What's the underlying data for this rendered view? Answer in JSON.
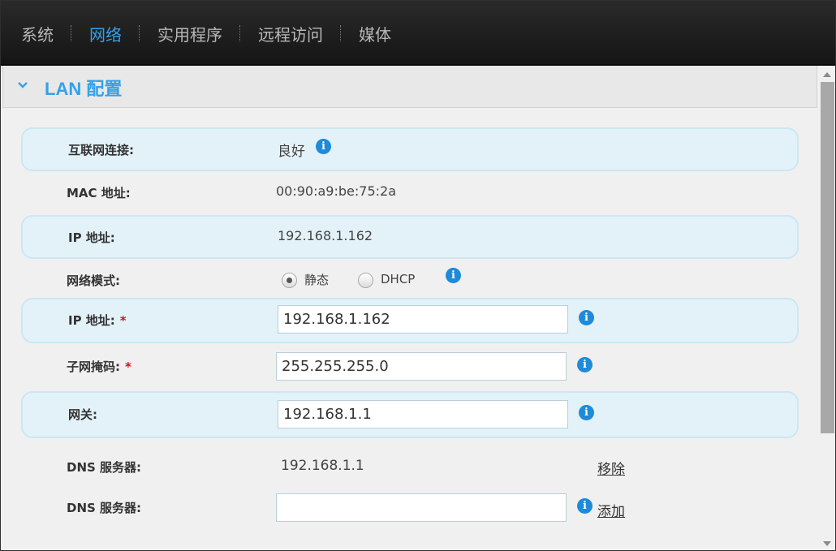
{
  "nav": {
    "items": [
      {
        "label": "系统",
        "active": false
      },
      {
        "label": "网络",
        "active": true
      },
      {
        "label": "实用程序",
        "active": false
      },
      {
        "label": "远程访问",
        "active": false
      },
      {
        "label": "媒体",
        "active": false
      }
    ]
  },
  "section": {
    "title": "LAN 配置",
    "icon": "chevron-down-icon"
  },
  "rows": {
    "internet": {
      "label": "互联网连接:",
      "value": "良好"
    },
    "mac": {
      "label": "MAC 地址:",
      "value": "00:90:a9:be:75:2a"
    },
    "ip_readonly": {
      "label": "IP 地址:",
      "value": "192.168.1.162"
    },
    "mode": {
      "label": "网络模式:",
      "options": [
        "静态",
        "DHCP"
      ],
      "selected": "静态"
    },
    "ip": {
      "label": "IP 地址:",
      "required": "*",
      "value": "192.168.1.162"
    },
    "subnet": {
      "label": "子网掩码:",
      "required": "*",
      "value": "255.255.255.0"
    },
    "gateway": {
      "label": "网关:",
      "value": "192.168.1.1"
    },
    "dns1": {
      "label": "DNS 服务器:",
      "value": "192.168.1.1",
      "action": "移除"
    },
    "dns2": {
      "label": "DNS 服务器:",
      "value": "",
      "action": "添加"
    }
  },
  "colors": {
    "accent": "#36a0e6",
    "band": "#e3f2f9",
    "info": "#1e8ad8",
    "required": "#d0101b"
  },
  "info_glyph": "i"
}
